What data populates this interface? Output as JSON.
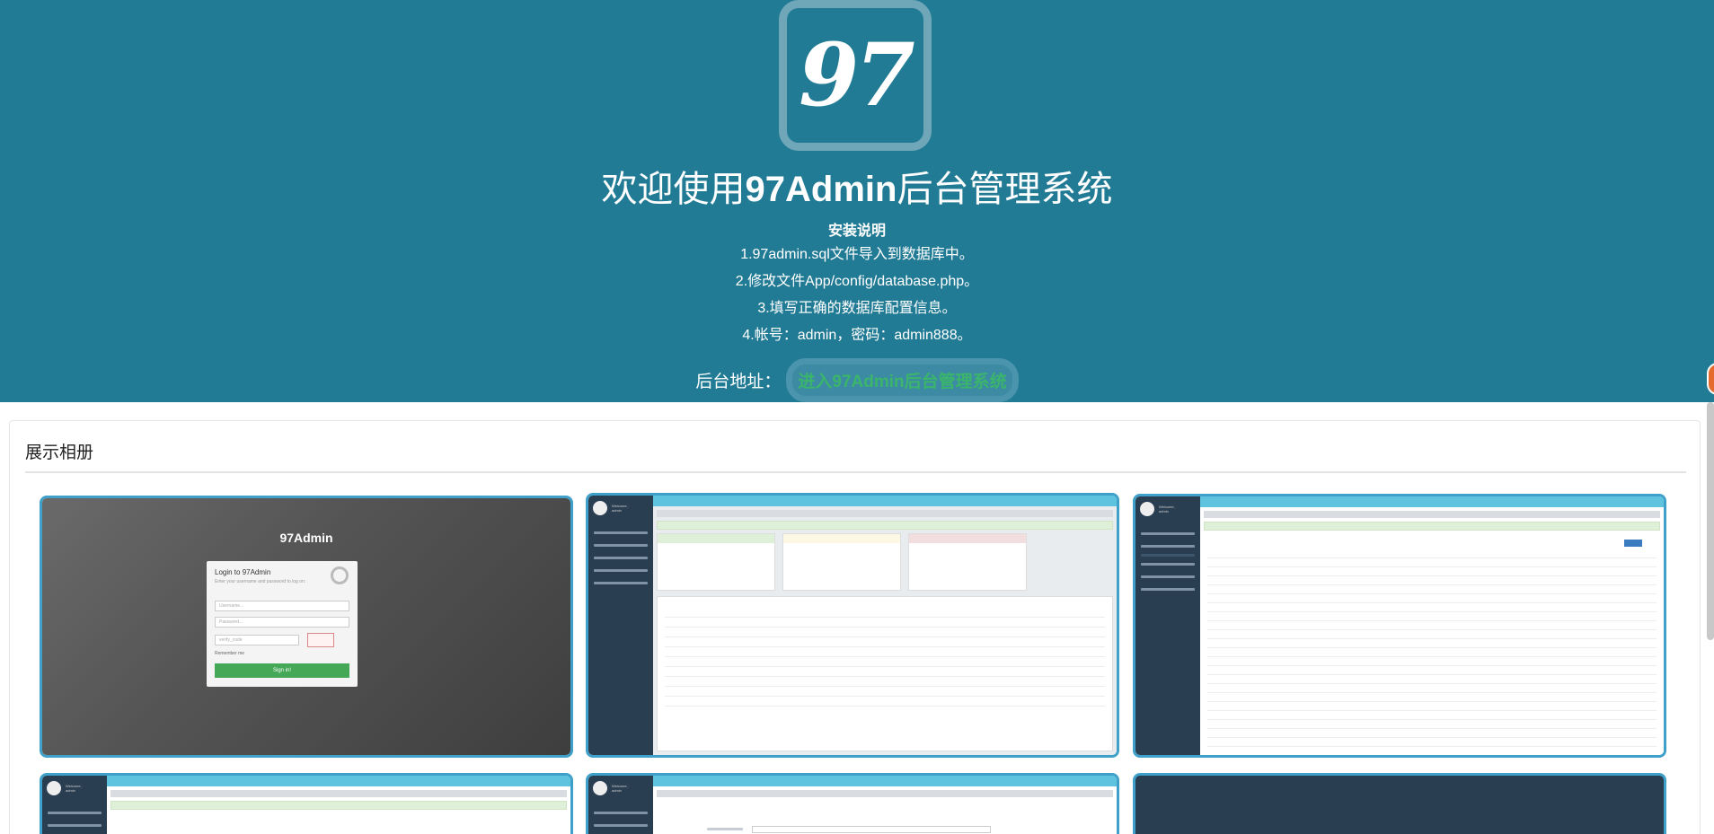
{
  "hero": {
    "logo_text": "97",
    "title_prefix": "欢迎使用",
    "title_bold": "97Admin",
    "title_suffix": "后台管理系统",
    "install_heading": "安装说明",
    "steps": [
      "1.97admin.sql文件导入到数据库中。",
      "2.修改文件App/config/database.php。",
      "3.填写正确的数据库配置信息。",
      "4.帐号：admin，密码：admin888。"
    ],
    "admin_label": "后台地址：",
    "admin_link": "进入97Admin后台管理系统"
  },
  "gallery": {
    "heading": "展示相册",
    "thumb_login": {
      "brand": "97Admin",
      "title": "Login to 97Admin",
      "subtitle": "Enter your username and password to log on:",
      "username_placeholder": "Username...",
      "password_placeholder": "Password...",
      "verify_placeholder": "verify_code",
      "remember": "Remember me",
      "signin": "Sign in!"
    },
    "mock_welcome": "Welcome,",
    "mock_user": "admin"
  },
  "colors": {
    "hero_bg": "#227b95",
    "accent_green": "#3ab56b",
    "thumb_border": "#3fa0c9",
    "mock_sidebar": "#2a3e52"
  }
}
